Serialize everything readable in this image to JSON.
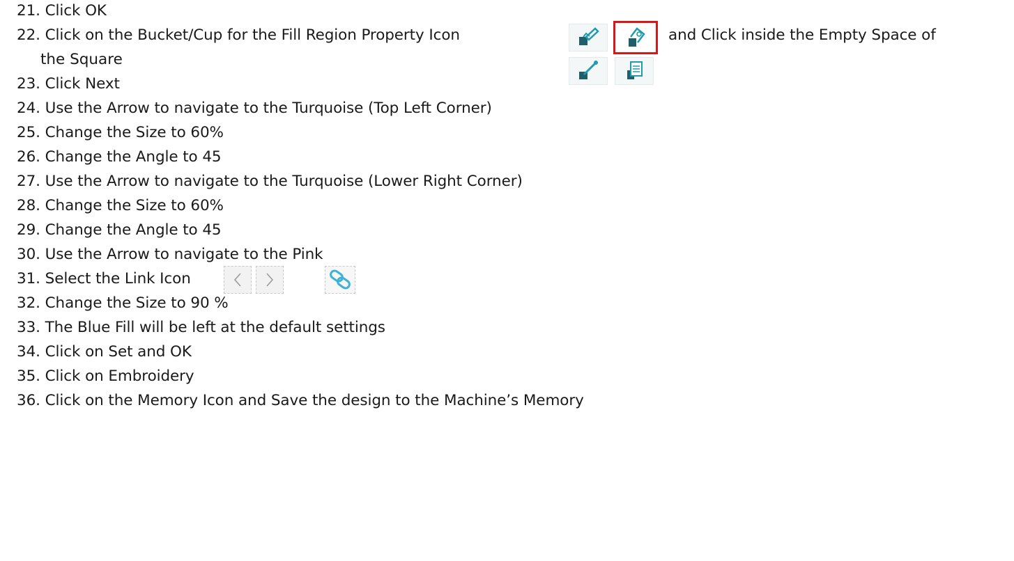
{
  "steps": [
    {
      "num": "21.",
      "text": "Click OK"
    },
    {
      "num": "22.",
      "text": "Click on the Bucket/Cup for the Fill Region Property Icon",
      "after_icon": "and  Click inside the Empty Space of",
      "continuation": "the Square"
    },
    {
      "num": "23.",
      "text": "Click Next"
    },
    {
      "num": "24.",
      "text": "Use the Arrow to navigate to the Turquoise (Top Left Corner)"
    },
    {
      "num": "25.",
      "text": "Change the Size to 60%"
    },
    {
      "num": "26.",
      "text": "Change the Angle to 45"
    },
    {
      "num": "27.",
      "text": "Use the Arrow to navigate to the Turquoise (Lower Right Corner)"
    },
    {
      "num": "28.",
      "text": "Change the Size to 60%"
    },
    {
      "num": "29.",
      "text": "Change the Angle to 45"
    },
    {
      "num": "30.",
      "text": "Use the Arrow to navigate to the Pink"
    },
    {
      "num": "31.",
      "text": "Select the Link Icon"
    },
    {
      "num": "32.",
      "text": "Change the Size to 90 %"
    },
    {
      "num": "33.",
      "text": "The Blue Fill will be left at the default settings"
    },
    {
      "num": "34.",
      "text": "Click on Set and OK"
    },
    {
      "num": "35.",
      "text": "Click on Embroidery"
    },
    {
      "num": "36.",
      "text": "Click on the Memory Icon and Save the design to the Machine’s Memory"
    }
  ],
  "icons": {
    "fill_panel": [
      "brush-fill-icon",
      "bucket-fill-icon",
      "eyedropper-icon",
      "fill-properties-icon"
    ],
    "nav": [
      "arrow-left-icon",
      "arrow-right-icon",
      "link-icon"
    ]
  },
  "colors": {
    "icon_teal": "#1f9bb0",
    "icon_dark": "#1f5f6a",
    "highlight_red": "#d21a1a",
    "link_blue": "#3ab3d6"
  }
}
